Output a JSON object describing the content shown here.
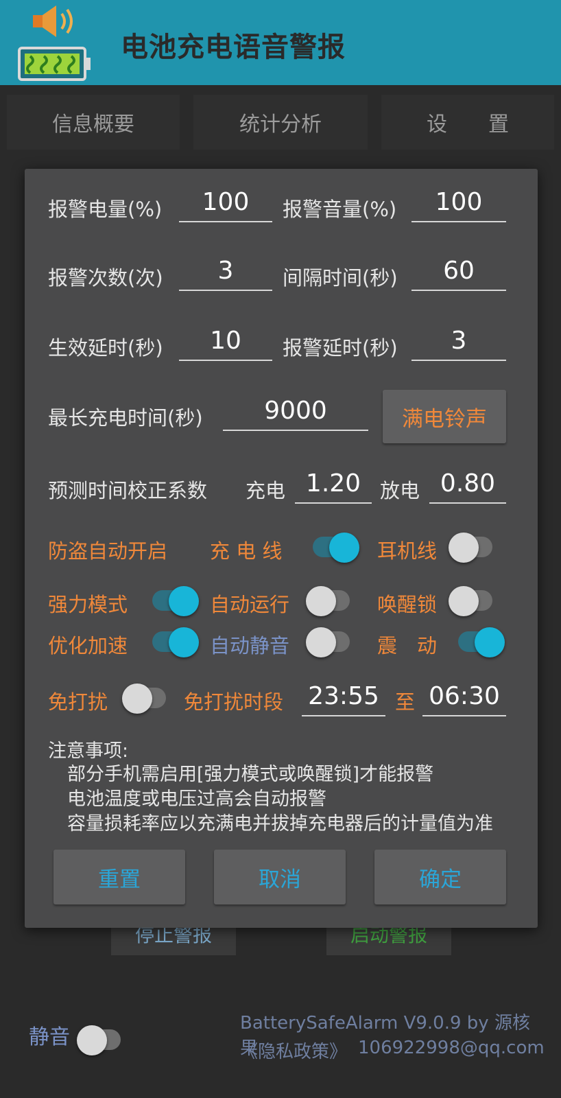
{
  "app": {
    "title": "电池充电语音警报"
  },
  "tabs": [
    {
      "label": "信息概要"
    },
    {
      "label": "统计分析"
    },
    {
      "label": "设　　置"
    }
  ],
  "background_buttons": {
    "stop": "停止警报",
    "start": "启动警报"
  },
  "footer": {
    "mute_label": "静音",
    "version": "BatterySafeAlarm V9.0.9 by 源核果",
    "privacy": "《隐私政策》",
    "contact": "106922998@qq.com"
  },
  "dialog": {
    "fields": {
      "alarm_level": {
        "label": "报警电量(%)",
        "value": "100"
      },
      "alarm_volume": {
        "label": "报警音量(%)",
        "value": "100"
      },
      "alarm_count": {
        "label": "报警次数(次)",
        "value": "3"
      },
      "interval": {
        "label": "间隔时间(秒)",
        "value": "60"
      },
      "effect_delay": {
        "label": "生效延时(秒)",
        "value": "10"
      },
      "alarm_delay": {
        "label": "报警延时(秒)",
        "value": "3"
      },
      "max_charge": {
        "label": "最长充电时间(秒)",
        "value": "9000"
      }
    },
    "ringtone_button": "满电铃声",
    "correction": {
      "label": "预测时间校正系数",
      "charge_label": "充电",
      "charge_value": "1.20",
      "discharge_label": "放电",
      "discharge_value": "0.80"
    },
    "antitheft": {
      "label": "防盗自动开启",
      "cable_label": "充 电 线",
      "cable_on": true,
      "earphone_label": "耳机线",
      "earphone_on": false
    },
    "toggles": {
      "force_mode": {
        "label": "强力模式",
        "on": true
      },
      "auto_run": {
        "label": "自动运行",
        "on": false
      },
      "wake_lock": {
        "label": "唤醒锁",
        "on": false
      },
      "optimize": {
        "label": "优化加速",
        "on": true
      },
      "auto_mute": {
        "label": "自动静音",
        "on": false
      },
      "vibrate": {
        "label": "震　动",
        "on": true
      }
    },
    "dnd": {
      "label": "免打扰",
      "on": false,
      "period_label": "免打扰时段",
      "start": "23:55",
      "to": "至",
      "end": "06:30"
    },
    "notes": {
      "title": "注意事项:",
      "lines": [
        "部分手机需启用[强力模式或唤醒锁]才能报警",
        "电池温度或电压过高会自动报警",
        "容量损耗率应以充满电并拔掉充电器后的计量值为准"
      ]
    },
    "buttons": {
      "reset": "重置",
      "cancel": "取消",
      "confirm": "确定"
    }
  },
  "colors": {
    "appbar": "#2094ad",
    "accent": "#18b5d8",
    "orange": "#f0883a",
    "dialog": "#4a4a4b"
  }
}
